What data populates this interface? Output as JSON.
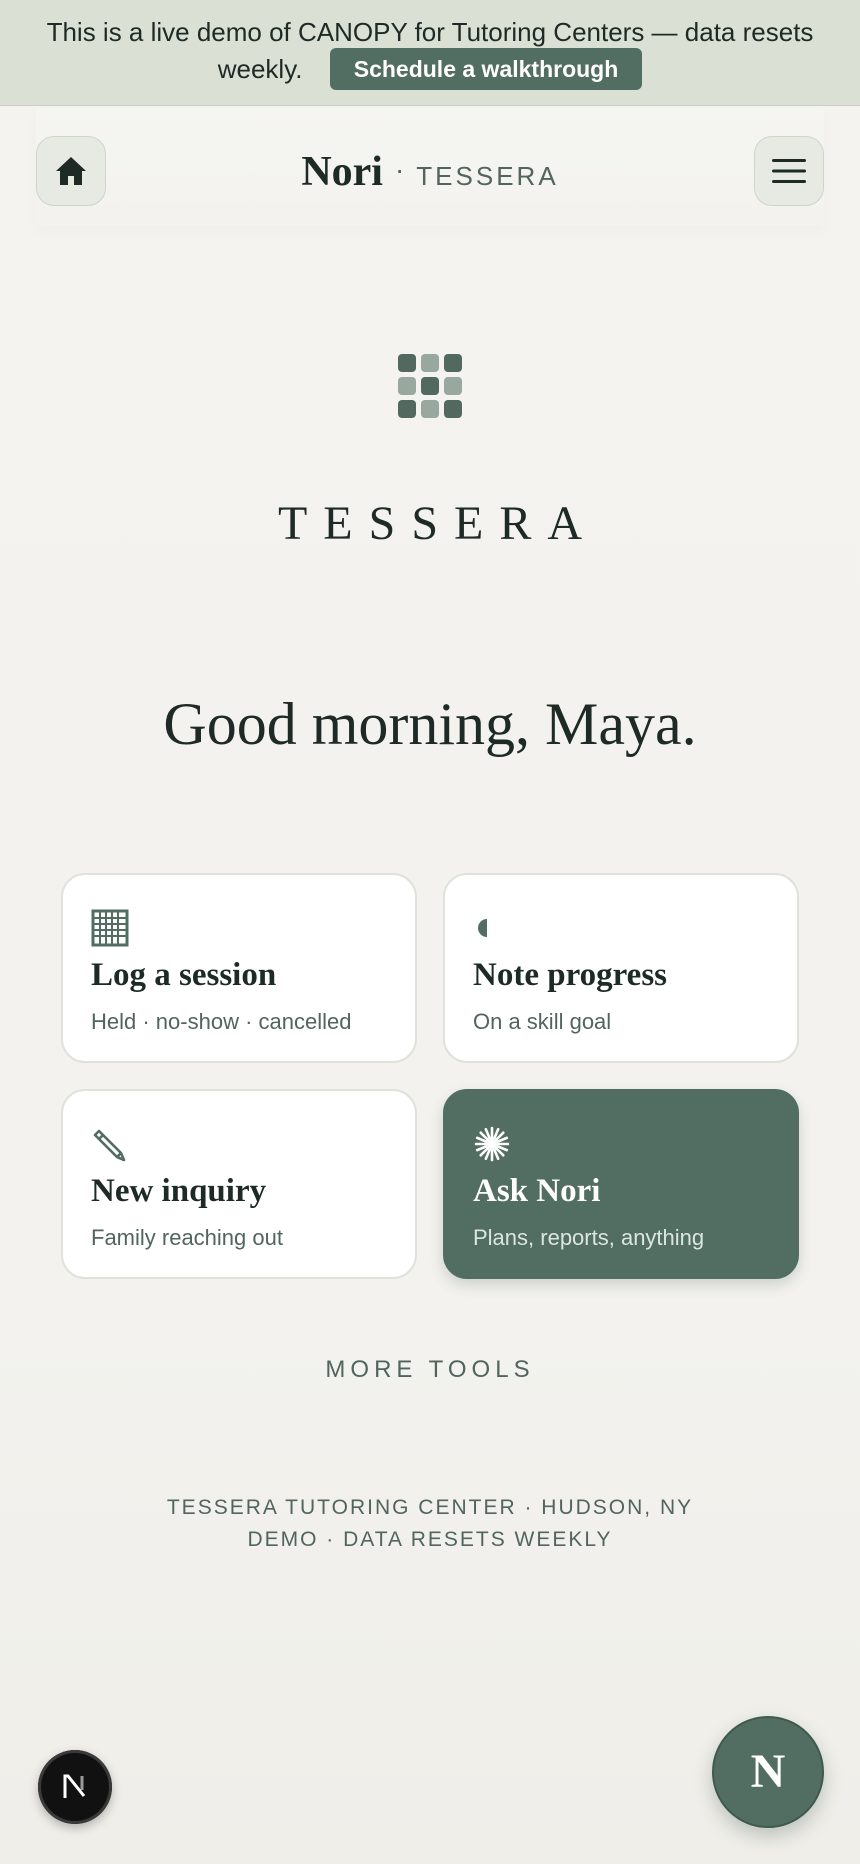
{
  "banner": {
    "message": "This is a live demo of CANOPY for Tutoring Centers — data resets weekly.",
    "cta_label": "Schedule a walkthrough"
  },
  "header": {
    "brand_name": "Nori",
    "separator": "·",
    "brand_sub": "TESSERA",
    "home_icon": "home-icon",
    "menu_icon": "hamburger-menu-icon"
  },
  "logo": {
    "wordmark": "TESSERA",
    "colors": {
      "dark": "#52695f",
      "light": "#98a89f"
    },
    "grid": [
      [
        "dark",
        "light",
        "dark"
      ],
      [
        "light",
        "dark",
        "light"
      ],
      [
        "dark",
        "light",
        "dark"
      ]
    ]
  },
  "greeting": "Good morning, Maya.",
  "actions": [
    {
      "title": "Log a session",
      "subtitle": "Held · no-show · cancelled",
      "icon": "grid-calendar-icon",
      "glyph": "▦"
    },
    {
      "title": "Note progress",
      "subtitle": "On a skill goal",
      "icon": "half-moon-icon",
      "glyph": "◖"
    },
    {
      "title": "New inquiry",
      "subtitle": "Family reaching out",
      "icon": "pencil-icon",
      "glyph": "✎"
    },
    {
      "title": "Ask Nori",
      "subtitle": "Plans, reports, anything",
      "icon": "sparkle-icon",
      "glyph": "✺"
    }
  ],
  "more_tools_label": "MORE TOOLS",
  "footer": {
    "line1": "TESSERA TUTORING CENTER · HUDSON, NY",
    "line2": "DEMO · DATA RESETS WEEKLY"
  },
  "fab": {
    "label": "N",
    "icon": "nori-assistant-icon"
  },
  "devtools": {
    "icon": "nextjs-devtools-icon"
  },
  "colors": {
    "accent": "#526d62",
    "banner_bg": "#dbe0d4",
    "page_bg": "#f4f3ef",
    "text_dark": "#1e2a25",
    "text_muted": "#52655d"
  }
}
